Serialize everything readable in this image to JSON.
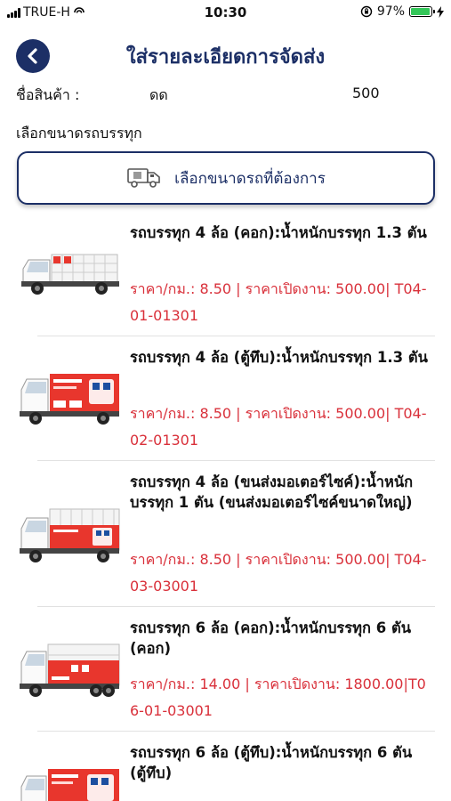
{
  "status_bar": {
    "carrier": "TRUE-H",
    "time": "10:30",
    "battery": "97%",
    "battery_level": 0.97
  },
  "header": {
    "title": "ใส่รายละเอียดการจัดส่ง"
  },
  "product": {
    "label": "ชื่อสินค้า :",
    "name": "ดด",
    "quantity": "500"
  },
  "vehicle_section": {
    "label": "เลือกขนาดรถบรรทุก",
    "select_button_label": "เลือกขนาดรถที่ต้องการ"
  },
  "trucks": [
    {
      "title": "รถบรรทุก 4 ล้อ (คอก):น้ำหนักบรรทุก 1.3 ตัน",
      "price": "ราคา/กม.: 8.50 | ราคาเปิดงาน: 500.00| T04-01-01301",
      "image": "pickup-cage-truck"
    },
    {
      "title": "รถบรรทุก 4 ล้อ (ตู้ทึบ):น้ำหนักบรรทุก 1.3 ตัน",
      "price": "ราคา/กม.: 8.50 | ราคาเปิดงาน: 500.00| T04-02-01301",
      "image": "box-truck-branded"
    },
    {
      "title": "รถบรรทุก 4 ล้อ (ขนส่งมอเตอร์ไซค์):น้ำหนักบรรทุก 1 ตัน (ขนส่งมอเตอร์ไซค์ขนาดใหญ่)",
      "price": "ราคา/กม.: 8.50 | ราคาเปิดงาน: 500.00| T04-03-03001",
      "image": "motorcycle-cage-truck"
    },
    {
      "title": "รถบรรทุก 6 ล้อ (คอก):น้ำหนักบรรทุก 6 ตัน (คอก)",
      "price": "ราคา/กม.: 14.00 | ราคาเปิดงาน: 1800.00|T06-01-03001",
      "image": "six-wheel-cage-truck"
    },
    {
      "title": "รถบรรทุก 6 ล้อ (ตู้ทึบ):น้ำหนักบรรทุก 6 ตัน (ตู้ทึบ)",
      "price": "",
      "image": "six-wheel-box-truck"
    }
  ],
  "colors": {
    "primary": "#1c2f66",
    "price": "#d9303a",
    "brand_red": "#e8362d",
    "battery": "#34c759"
  }
}
